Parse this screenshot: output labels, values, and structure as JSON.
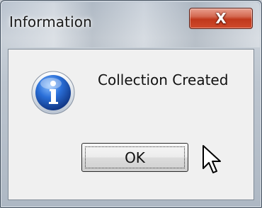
{
  "window": {
    "title": "Information",
    "close_label": "X"
  },
  "dialog": {
    "message": "Collection Created",
    "icon": "info-icon",
    "ok_label": "OK"
  },
  "colors": {
    "close_button": "#c0381c",
    "info_icon": "#1a4fb0"
  }
}
